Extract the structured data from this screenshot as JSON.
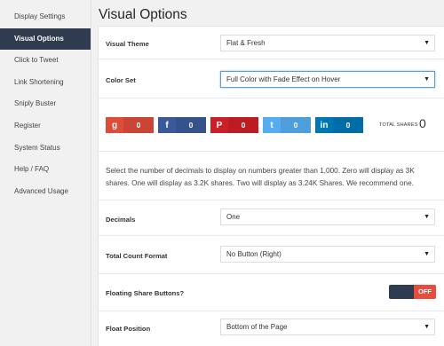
{
  "sidebar": {
    "items": [
      {
        "label": "Display Settings"
      },
      {
        "label": "Visual Options"
      },
      {
        "label": "Click to Tweet"
      },
      {
        "label": "Link Shortening"
      },
      {
        "label": "Sniply Buster"
      },
      {
        "label": "Register"
      },
      {
        "label": "System Status"
      },
      {
        "label": "Help / FAQ"
      },
      {
        "label": "Advanced Usage"
      }
    ],
    "active_index": 1
  },
  "page_title": "Visual Options",
  "visual_theme": {
    "label": "Visual Theme",
    "value": "Flat & Fresh"
  },
  "color_set": {
    "label": "Color Set",
    "value": "Full Color with Fade Effect on Hover"
  },
  "share_preview": {
    "buttons": [
      {
        "icon": "g",
        "count": "0",
        "color": "#dd4b39",
        "icon_name": "google-plus-icon"
      },
      {
        "icon": "f",
        "count": "0",
        "color": "#3b5998",
        "icon_name": "facebook-icon"
      },
      {
        "icon": "P",
        "count": "0",
        "color": "#cb2027",
        "icon_name": "pinterest-icon"
      },
      {
        "icon": "t",
        "count": "0",
        "color": "#55acee",
        "icon_name": "twitter-icon"
      },
      {
        "icon": "in",
        "count": "0",
        "color": "#0077b5",
        "icon_name": "linkedin-icon"
      }
    ],
    "total_label": "TOTAL SHARES",
    "total_value": "0"
  },
  "decimals_description": "Select the number of decimals to display on numbers greater than 1,000. Zero will display as 3K shares. One will display as 3.2K shares. Two will display as 3.24K Shares. We recommend one.",
  "decimals": {
    "label": "Decimals",
    "value": "One"
  },
  "total_count_format": {
    "label": "Total Count Format",
    "value": "No Button (Right)"
  },
  "floating_share": {
    "label": "Floating Share Buttons?",
    "toggle_text": "OFF"
  },
  "float_position": {
    "label": "Float Position",
    "value": "Bottom of the Page"
  },
  "colors": {
    "accent": "#2f3b4f",
    "toggle_off": "#e74c3c"
  }
}
